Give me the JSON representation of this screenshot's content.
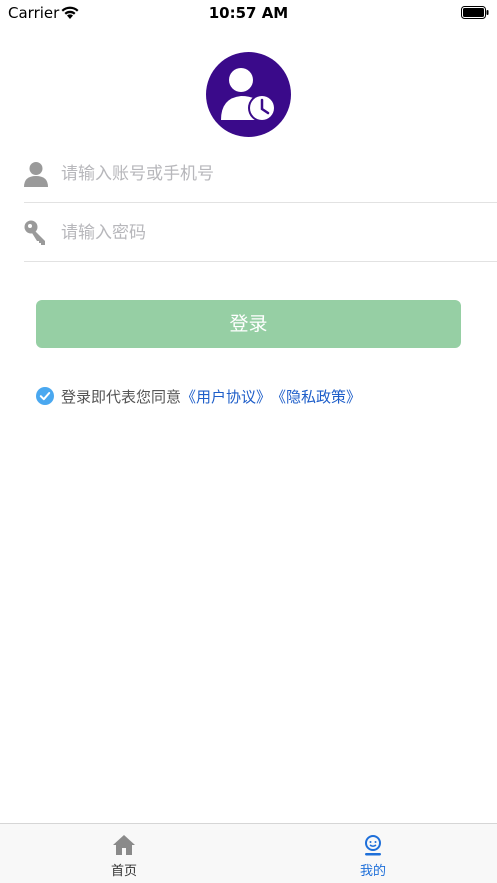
{
  "status_bar": {
    "carrier": "Carrier",
    "time": "10:57 AM"
  },
  "login_form": {
    "account_placeholder": "请输入账号或手机号",
    "password_placeholder": "请输入密码",
    "login_label": "登录",
    "agreement_prefix": "登录即代表您同意",
    "user_agreement": "《用户协议》",
    "privacy_policy": "《隐私政策》",
    "agreement_checked": true
  },
  "tab_bar": {
    "items": [
      {
        "label": "首页",
        "icon": "home-icon",
        "selected": false
      },
      {
        "label": "我的",
        "icon": "profile-icon",
        "selected": true
      }
    ]
  },
  "colors": {
    "avatar_bg": "#3a0a8a",
    "login_button": "#96cfa4",
    "link": "#1e5ec9",
    "tab_selected": "#1e6fd9",
    "check": "#4aa8f0"
  }
}
